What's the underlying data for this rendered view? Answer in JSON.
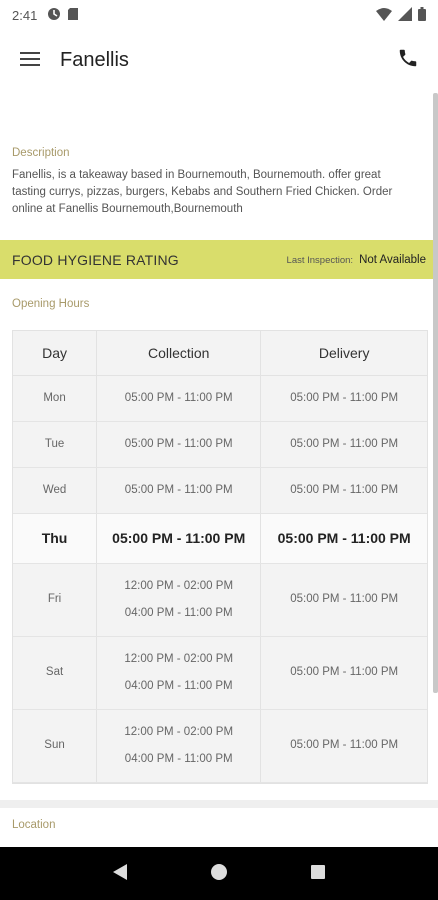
{
  "status_bar": {
    "time": "2:41",
    "icons": [
      "sync-icon",
      "sd-card-icon",
      "wifi-icon",
      "signal-icon",
      "battery-icon"
    ]
  },
  "app_bar": {
    "title": "Fanellis",
    "menu_icon": "hamburger-menu-icon",
    "action_icon": "phone-icon"
  },
  "description": {
    "label": "Description",
    "text": "Fanellis, is a takeaway based in Bournemouth, Bournemouth. offer great tasting currys, pizzas, burgers, Kebabs and Southern Fried Chicken. Order online at Fanellis Bournemouth,Bournemouth"
  },
  "hygiene": {
    "title": "FOOD HYGIENE RATING",
    "last_inspection_label": "Last Inspection:",
    "last_inspection_value": "Not Available"
  },
  "opening_hours": {
    "label": "Opening Hours",
    "headers": [
      "Day",
      "Collection",
      "Delivery"
    ],
    "rows": [
      {
        "day": "Mon",
        "collection": [
          "05:00 PM - 11:00 PM"
        ],
        "delivery": [
          "05:00 PM - 11:00 PM"
        ],
        "today": false
      },
      {
        "day": "Tue",
        "collection": [
          "05:00 PM - 11:00 PM"
        ],
        "delivery": [
          "05:00 PM - 11:00 PM"
        ],
        "today": false
      },
      {
        "day": "Wed",
        "collection": [
          "05:00 PM - 11:00 PM"
        ],
        "delivery": [
          "05:00 PM - 11:00 PM"
        ],
        "today": false
      },
      {
        "day": "Thu",
        "collection": [
          "05:00 PM - 11:00 PM"
        ],
        "delivery": [
          "05:00 PM - 11:00 PM"
        ],
        "today": true
      },
      {
        "day": "Fri",
        "collection": [
          "12:00 PM - 02:00 PM",
          "04:00 PM - 11:00 PM"
        ],
        "delivery": [
          "05:00 PM - 11:00 PM"
        ],
        "today": false
      },
      {
        "day": "Sat",
        "collection": [
          "12:00 PM - 02:00 PM",
          "04:00 PM - 11:00 PM"
        ],
        "delivery": [
          "05:00 PM - 11:00 PM"
        ],
        "today": false
      },
      {
        "day": "Sun",
        "collection": [
          "12:00 PM - 02:00 PM",
          "04:00 PM - 11:00 PM"
        ],
        "delivery": [
          "05:00 PM - 11:00 PM"
        ],
        "today": false
      }
    ]
  },
  "location": {
    "label": "Location"
  },
  "nav_bar": {
    "buttons": [
      "back-icon",
      "home-icon",
      "recents-icon"
    ]
  },
  "colors": {
    "accent_label": "#a89a6a",
    "hygiene_banner": "#d9dd6b",
    "table_bg": "#f3f3f3"
  }
}
